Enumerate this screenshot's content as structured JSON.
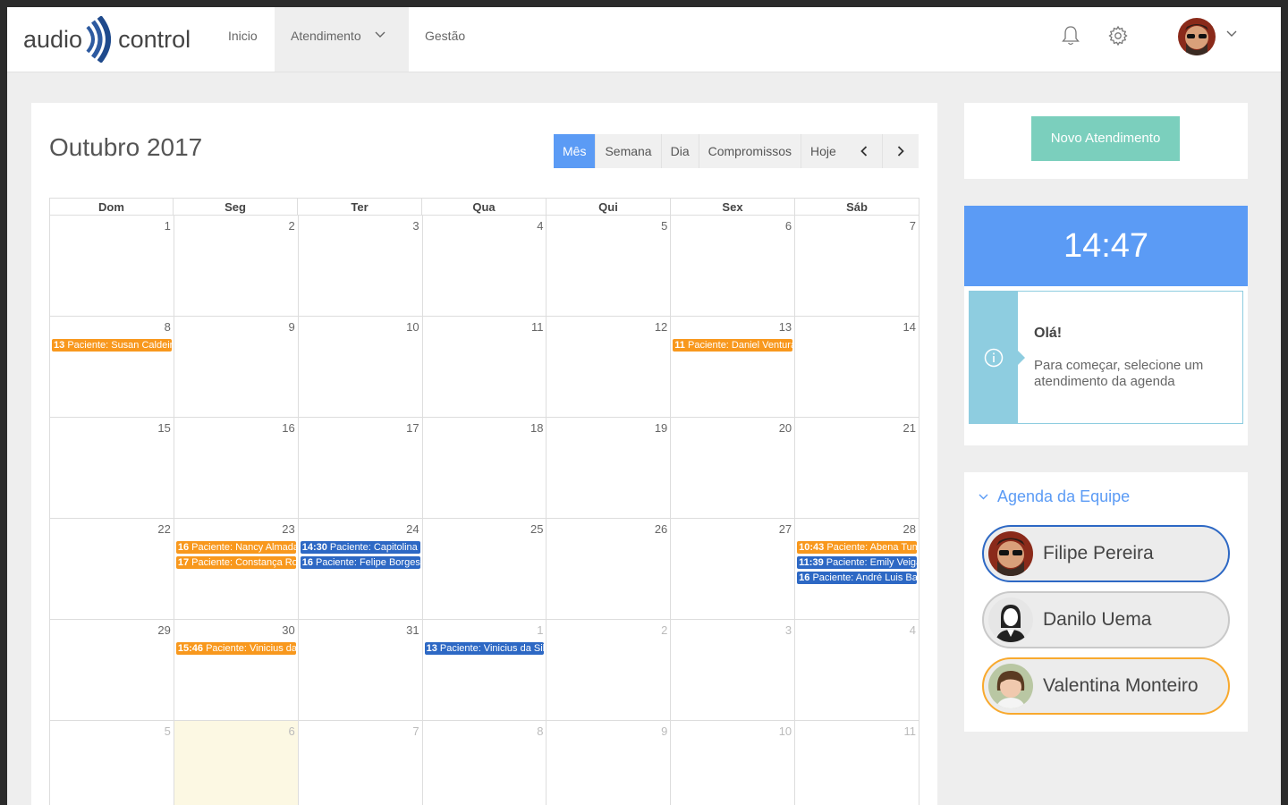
{
  "header": {
    "logo_left": "audio",
    "logo_right": "control",
    "nav": {
      "inicio": "Inicio",
      "atendimento": "Atendimento",
      "gestao": "Gestão"
    },
    "icons": [
      "bell-icon",
      "gear-icon",
      "chevron-down-icon"
    ]
  },
  "calendar": {
    "title": "Outubro 2017",
    "views": [
      "Mês",
      "Semana",
      "Dia",
      "Compromissos",
      "Hoje"
    ],
    "active_view": "Mês",
    "days_of_week": [
      "Dom",
      "Seg",
      "Ter",
      "Qua",
      "Qui",
      "Sex",
      "Sáb"
    ],
    "weeks": [
      [
        {
          "n": "1"
        },
        {
          "n": "2"
        },
        {
          "n": "3"
        },
        {
          "n": "4"
        },
        {
          "n": "5"
        },
        {
          "n": "6"
        },
        {
          "n": "7"
        }
      ],
      [
        {
          "n": "8",
          "events": [
            {
              "time": "13",
              "text": "Paciente: Susan Caldeira",
              "color": "orange"
            }
          ]
        },
        {
          "n": "9"
        },
        {
          "n": "10"
        },
        {
          "n": "11"
        },
        {
          "n": "12"
        },
        {
          "n": "13",
          "events": [
            {
              "time": "11",
              "text": "Paciente: Daniel Ventura",
              "color": "orange"
            }
          ]
        },
        {
          "n": "14"
        }
      ],
      [
        {
          "n": "15"
        },
        {
          "n": "16"
        },
        {
          "n": "17"
        },
        {
          "n": "18"
        },
        {
          "n": "19"
        },
        {
          "n": "20"
        },
        {
          "n": "21"
        }
      ],
      [
        {
          "n": "22"
        },
        {
          "n": "23",
          "events": [
            {
              "time": "16",
              "text": "Paciente: Nancy Almada",
              "color": "orange"
            },
            {
              "time": "17",
              "text": "Paciente: Constança Rocha",
              "color": "orange"
            }
          ]
        },
        {
          "n": "24",
          "events": [
            {
              "time": "14:30",
              "text": "Paciente: Capitolina",
              "color": "blue"
            },
            {
              "time": "16",
              "text": "Paciente: Felipe Borges",
              "color": "blue"
            }
          ]
        },
        {
          "n": "25"
        },
        {
          "n": "26"
        },
        {
          "n": "27"
        },
        {
          "n": "28",
          "events": [
            {
              "time": "10:43",
              "text": "Paciente: Abena Tuma",
              "color": "orange"
            },
            {
              "time": "11:39",
              "text": "Paciente: Emily Veiga",
              "color": "blue"
            },
            {
              "time": "16",
              "text": "Paciente: André Luis Bastos",
              "color": "blue"
            }
          ]
        }
      ],
      [
        {
          "n": "29"
        },
        {
          "n": "30",
          "events": [
            {
              "time": "15:46",
              "text": "Paciente: Vinicius da Silva",
              "color": "orange"
            }
          ]
        },
        {
          "n": "31"
        },
        {
          "n": "1",
          "other": true,
          "events": [
            {
              "time": "13",
              "text": "Paciente: Vinicius da Silva",
              "color": "blue"
            }
          ]
        },
        {
          "n": "2",
          "other": true
        },
        {
          "n": "3",
          "other": true
        },
        {
          "n": "4",
          "other": true
        }
      ],
      [
        {
          "n": "5",
          "other": true
        },
        {
          "n": "6",
          "other": true,
          "today": true
        },
        {
          "n": "7",
          "other": true
        },
        {
          "n": "8",
          "other": true
        },
        {
          "n": "9",
          "other": true
        },
        {
          "n": "10",
          "other": true
        },
        {
          "n": "11",
          "other": true
        }
      ]
    ],
    "colors": {
      "orange": "#f8981d",
      "blue": "#2d68c4",
      "active_view": "#5b9bf5",
      "today": "#fcf8e3"
    }
  },
  "sidebar": {
    "novo_button": "Novo Atendimento",
    "clock": "14:47",
    "info_title": "Olá!",
    "info_text": "Para começar, selecione um atendimento da agenda",
    "team_title": "Agenda da Equipe",
    "team": [
      {
        "name": "Filipe Pereira",
        "border": "#2d68c4"
      },
      {
        "name": "Danilo Uema",
        "border": "#c9c9c9"
      },
      {
        "name": "Valentina Monteiro",
        "border": "#f8a92e"
      }
    ]
  }
}
